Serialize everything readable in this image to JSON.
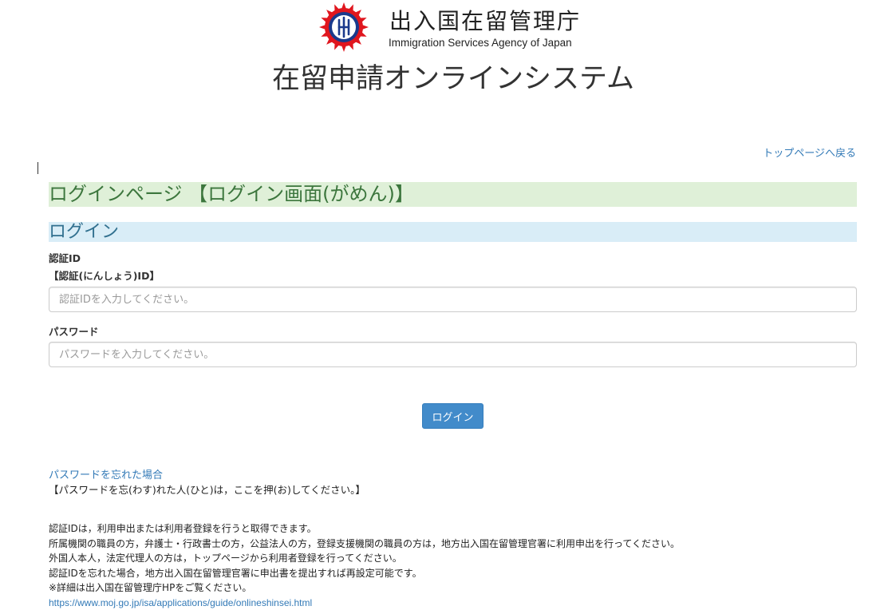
{
  "header": {
    "agency_name_jp": "出入国在留管理庁",
    "agency_name_en": "Immigration Services Agency of Japan",
    "system_title": "在留申請オンラインシステム",
    "emblem_icon": "agency-emblem-icon"
  },
  "nav": {
    "back_to_top": "トップページへ戻る"
  },
  "page": {
    "heading": "ログインページ 【ログイン画面(がめん)】",
    "section_heading": "ログイン"
  },
  "form": {
    "auth_id_label": "認証ID",
    "auth_id_label_ruby": "【認証(にんしょう)ID】",
    "auth_id_placeholder": "認証IDを入力してください。",
    "auth_id_value": "",
    "password_label": "パスワード",
    "password_placeholder": "パスワードを入力してください。",
    "password_value": "",
    "login_button": "ログイン"
  },
  "forgot": {
    "link": "パスワードを忘れた場合",
    "note": "【パスワードを忘(わす)れた人(ひと)は，ここを押(お)してください。】"
  },
  "notes": [
    "認証IDは，利用申出または利用者登録を行うと取得できます。",
    "所属機関の職員の方，弁護士・行政書士の方，公益法人の方，登録支援機関の職員の方は，地方出入国在留管理官署に利用申出を行ってください。",
    "外国人本人，法定代理人の方は，トップページから利用者登録を行ってください。",
    "認証IDを忘れた場合，地方出入国在留管理官署に申出書を提出すれば再設定可能です。",
    "※詳細は出入国在留管理庁HPをご覧ください。"
  ],
  "notes_url": "https://www.moj.go.jp/isa/applications/guide/onlineshinsei.html",
  "colors": {
    "link": "#337ab7",
    "heading_green_bg": "#dff0d8",
    "heading_green_text": "#3c763d",
    "heading_blue_bg": "#d9edf7",
    "heading_blue_text": "#31708f",
    "button_primary": "#428bca",
    "emblem_red": "#e0161e"
  }
}
